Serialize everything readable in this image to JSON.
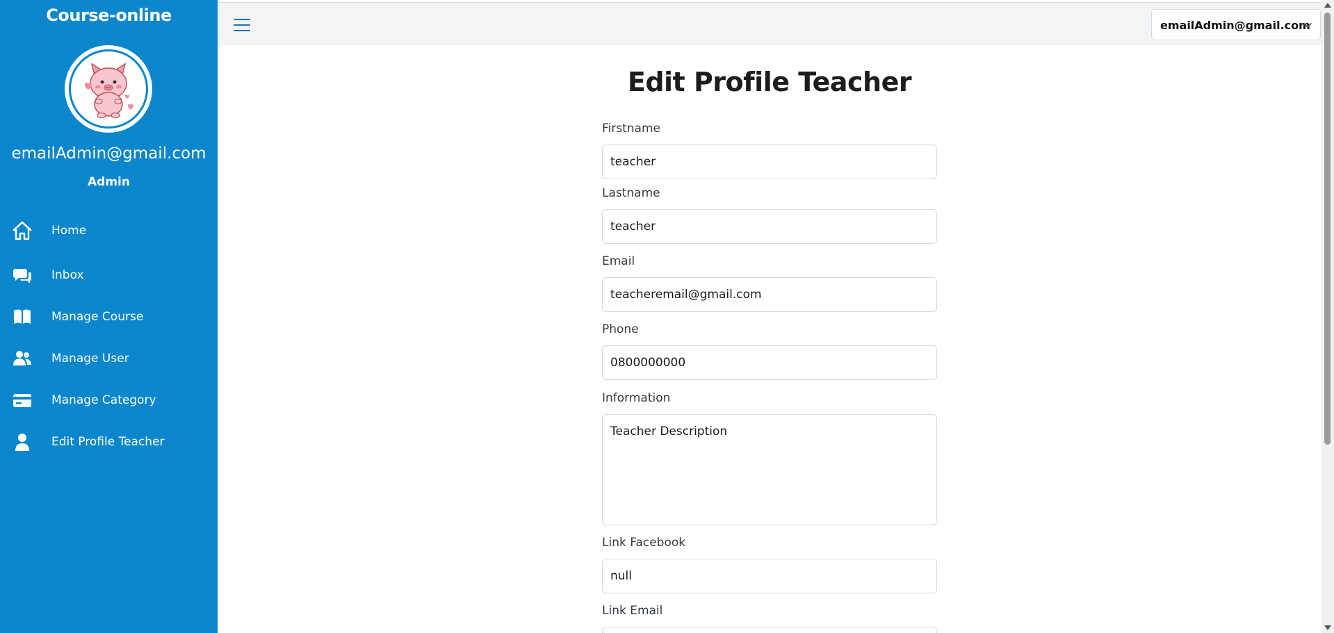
{
  "sidebar": {
    "brand": "Course-online",
    "user_email": "emailAdmin@gmail.com",
    "user_role": "Admin",
    "items": [
      {
        "label": "Home",
        "icon": "home-icon"
      },
      {
        "label": "Inbox",
        "icon": "chat-icon"
      },
      {
        "label": "Manage Course",
        "icon": "book-icon"
      },
      {
        "label": "Manage User",
        "icon": "users-icon"
      },
      {
        "label": "Manage Category",
        "icon": "card-icon"
      },
      {
        "label": "Edit Profile Teacher",
        "icon": "user-icon"
      }
    ]
  },
  "topbar": {
    "account_label": "emailAdmin@gmail.com"
  },
  "form": {
    "title": "Edit Profile Teacher",
    "firstname_label": "Firstname",
    "firstname_value": "teacher",
    "lastname_label": "Lastname",
    "lastname_value": "teacher",
    "email_label": "Email",
    "email_value": "teacheremail@gmail.com",
    "phone_label": "Phone",
    "phone_value": "0800000000",
    "information_label": "Information",
    "information_value": "Teacher Description",
    "facebook_label": "Link Facebook",
    "facebook_value": "null",
    "link_email_label": "Link Email",
    "link_email_value": ""
  },
  "colors": {
    "sidebar_bg": "#0a86cc",
    "topbar_bg": "#f3f4f6",
    "text_dark": "#1d1d1d"
  }
}
